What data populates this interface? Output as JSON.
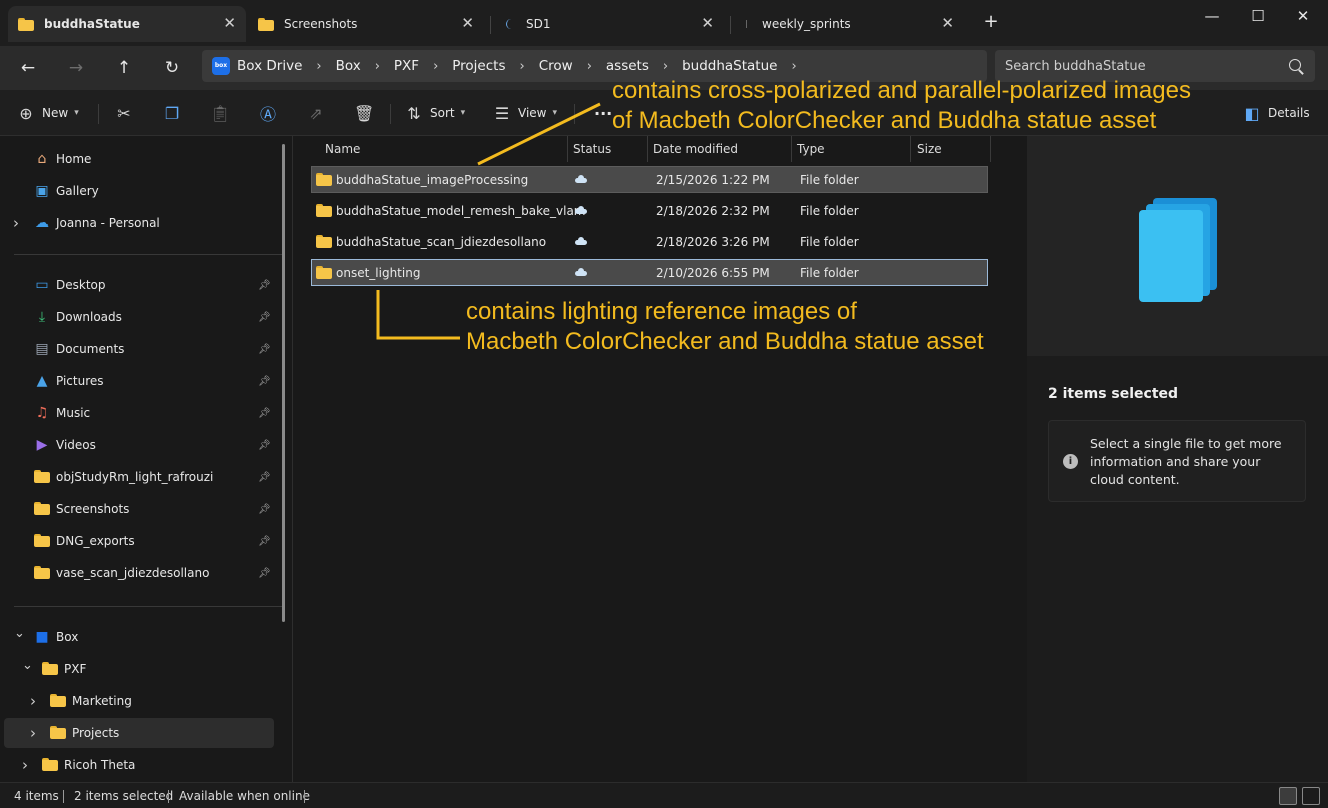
{
  "tabs": [
    {
      "title": "buddhaStatue",
      "active": true,
      "icon": "folder-icon"
    },
    {
      "title": "Screenshots",
      "active": false,
      "icon": "folder-icon"
    },
    {
      "title": "SD1",
      "active": false,
      "icon": "loading-icon"
    },
    {
      "title": "weekly_sprints",
      "active": false,
      "icon": "loading-icon"
    }
  ],
  "window_controls": {
    "new_tab": "+",
    "minimize": "—",
    "maximize": "☐",
    "close": "✕"
  },
  "breadcrumb": [
    "Box Drive",
    "Box",
    "PXF",
    "Projects",
    "Crow",
    "assets",
    "buddhaStatue"
  ],
  "box_logo_text": "box",
  "search": {
    "placeholder": "Search buddhaStatue"
  },
  "commandbar": {
    "new": "New",
    "sort": "Sort",
    "view": "View",
    "more": "···",
    "details": "Details"
  },
  "sidebar": {
    "quick": [
      {
        "label": "Home",
        "icon": "home-icon"
      },
      {
        "label": "Gallery",
        "icon": "gallery-icon"
      },
      {
        "label": "Joanna - Personal",
        "icon": "onedrive-cloud-icon"
      }
    ],
    "pinned": [
      {
        "label": "Desktop",
        "icon": "desktop-icon"
      },
      {
        "label": "Downloads",
        "icon": "download-icon"
      },
      {
        "label": "Documents",
        "icon": "document-icon"
      },
      {
        "label": "Pictures",
        "icon": "pictures-icon"
      },
      {
        "label": "Music",
        "icon": "music-icon"
      },
      {
        "label": "Videos",
        "icon": "video-icon"
      },
      {
        "label": "objStudyRm_light_rafrouzi",
        "icon": "folder-icon"
      },
      {
        "label": "Screenshots",
        "icon": "folder-icon"
      },
      {
        "label": "DNG_exports",
        "icon": "folder-icon"
      },
      {
        "label": "vase_scan_jdiezdesollano",
        "icon": "folder-icon"
      }
    ],
    "tree": [
      {
        "label": "Box",
        "icon": "box-icon",
        "expanded": true
      },
      {
        "label": "PXF",
        "icon": "folder-icon",
        "expanded": true
      },
      {
        "label": "Marketing",
        "icon": "folder-icon",
        "expanded": false
      },
      {
        "label": "Projects",
        "icon": "folder-icon",
        "expanded": false,
        "selected": true
      },
      {
        "label": "Ricoh Theta",
        "icon": "folder-icon",
        "expanded": false
      }
    ]
  },
  "columns": {
    "name": "Name",
    "status": "Status",
    "date": "Date modified",
    "type": "Type",
    "size": "Size"
  },
  "files": [
    {
      "name": "buddhaStatue_imageProcessing",
      "status": "cloud-icon",
      "date": "2/15/2026 1:22 PM",
      "type": "File folder",
      "selected": true
    },
    {
      "name": "buddhaStatue_model_remesh_bake_vlam",
      "status": "cloud-icon",
      "date": "2/18/2026 2:32 PM",
      "type": "File folder",
      "selected": false
    },
    {
      "name": "buddhaStatue_scan_jdiezdesollano",
      "status": "cloud-icon",
      "date": "2/18/2026 3:26 PM",
      "type": "File folder",
      "selected": false
    },
    {
      "name": "onset_lighting",
      "status": "cloud-icon",
      "date": "2/10/2026 6:55 PM",
      "type": "File folder",
      "selected": true
    }
  ],
  "details": {
    "selected_count": "2 items selected",
    "info": "Select a single file to get more information and share your cloud content."
  },
  "statusbar": {
    "items": "4 items",
    "selected": "2 items selected",
    "availability": "Available when online"
  },
  "annotations": {
    "top_line1": "contains cross-polarized and parallel-polarized images",
    "top_line2": "of Macbeth ColorChecker and Buddha statue asset",
    "mid_line1": "contains lighting reference images of",
    "mid_line2": "Macbeth ColorChecker and Buddha statue asset",
    "color": "#f3bb1f"
  },
  "colors": {
    "folder": "#f6c548",
    "accent_blue": "#5fa8f5",
    "selection": "#4a4a4a",
    "background": "#191919"
  }
}
